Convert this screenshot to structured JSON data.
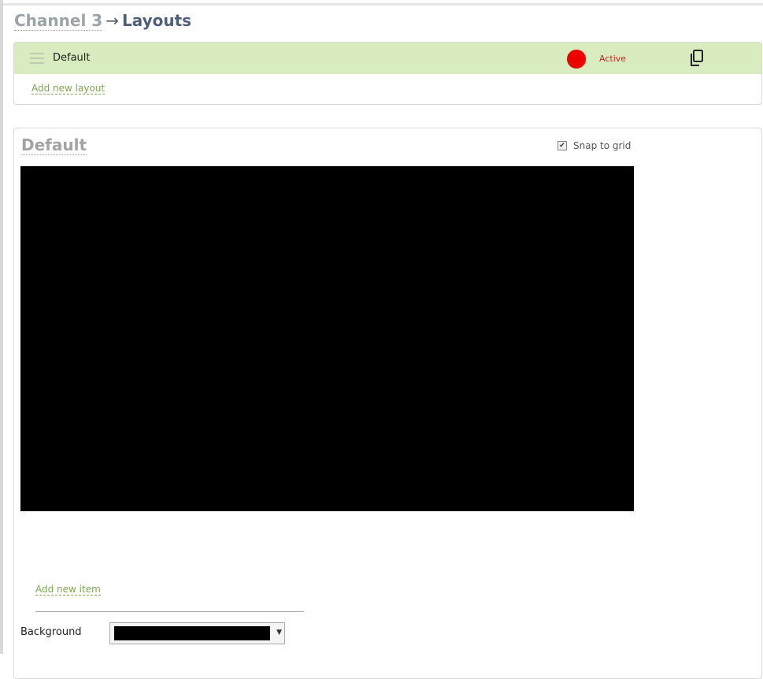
{
  "breadcrumb": {
    "parent": "Channel 3",
    "separator": "→",
    "current": "Layouts"
  },
  "layouts": {
    "items": [
      {
        "name": "Default",
        "status": "Active"
      }
    ],
    "add_link": "Add new layout"
  },
  "editor": {
    "title": "Default",
    "snap_to_grid": {
      "label": "Snap to grid",
      "checked": true
    },
    "canvas_color": "#000000",
    "add_item_link": "Add new item",
    "background": {
      "label": "Background",
      "value": "#000000"
    }
  },
  "colors": {
    "active_row": "#d8ecbf",
    "status_active": "#ee0000",
    "link": "#7fa650"
  },
  "icons": [
    "drag-handle-icon",
    "copy-icon",
    "checkbox-checked-icon",
    "dropdown-arrow-icon"
  ]
}
